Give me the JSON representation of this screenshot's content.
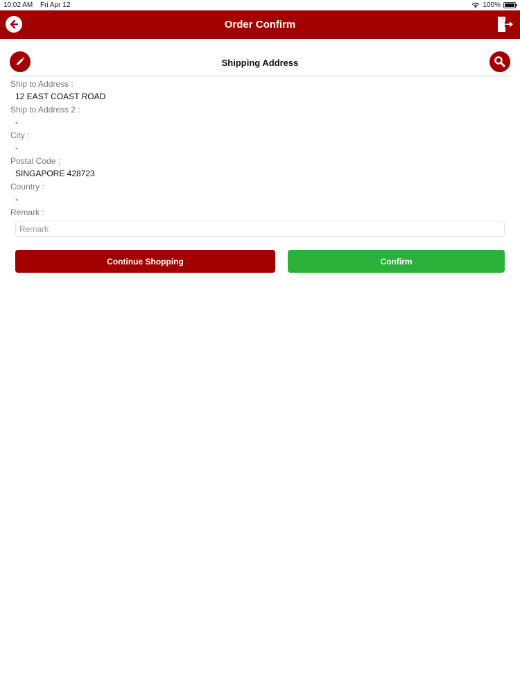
{
  "status_bar": {
    "time": "10:02 AM",
    "date": "Fri Apr 12",
    "battery_text": "100%",
    "wifi_icon": "wifi-icon",
    "battery_icon": "battery-icon"
  },
  "nav": {
    "title": "Order Confirm",
    "back_icon": "back-arrow-icon",
    "logout_icon": "logout-icon",
    "bar_color": "#a30000"
  },
  "section": {
    "title": "Shipping Address",
    "edit_icon": "pencil-icon",
    "search_icon": "search-icon"
  },
  "fields": [
    {
      "label": "Ship to Address :",
      "value": "12 EAST COAST ROAD"
    },
    {
      "label": "Ship to Address 2 :",
      "value": "-"
    },
    {
      "label": "City :",
      "value": "-"
    },
    {
      "label": "Postal Code :",
      "value": "SINGAPORE 428723"
    },
    {
      "label": "Country :",
      "value": "-"
    },
    {
      "label": "Remark :"
    }
  ],
  "remark": {
    "placeholder": "Remark",
    "value": ""
  },
  "buttons": {
    "continue_label": "Continue Shopping",
    "confirm_label": "Confirm",
    "continue_color": "#a30000",
    "confirm_color": "#2bb03a"
  }
}
